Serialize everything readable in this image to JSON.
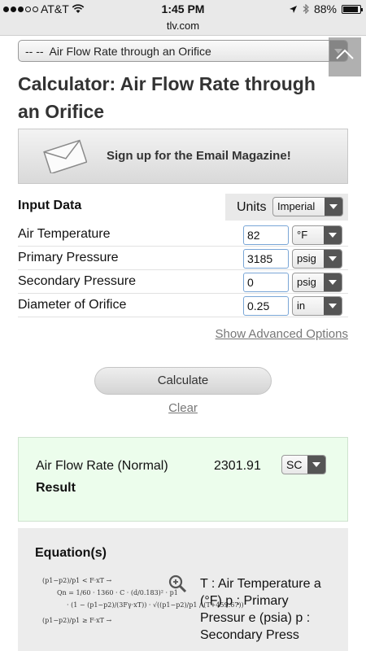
{
  "status_bar": {
    "carrier": "AT&T",
    "time": "1:45 PM",
    "battery": "88%",
    "battery_level": 0.88
  },
  "url": "tlv.com",
  "calculator_select": {
    "selected": "-- --  Air Flow Rate through an Orifice"
  },
  "page_title": "Calculator: Air Flow Rate through an Orifice",
  "banner": {
    "text": "Sign up for the Email Magazine!"
  },
  "input": {
    "heading": "Input Data",
    "units_label": "Units",
    "units_value": "Imperial",
    "rows": [
      {
        "label": "Air Temperature",
        "value": "82",
        "unit": "°F"
      },
      {
        "label": "Primary Pressure",
        "value": "3185",
        "unit": "psig"
      },
      {
        "label": "Secondary Pressure",
        "value": "0",
        "unit": "psig"
      },
      {
        "label": "Diameter of Orifice",
        "value": "0.25",
        "unit": "in"
      }
    ],
    "advanced_link": "Show Advanced Options"
  },
  "actions": {
    "calculate": "Calculate",
    "clear": "Clear"
  },
  "result": {
    "label": "Air Flow Rate (Normal)",
    "value": "2301.91",
    "unit": "SC",
    "heading": "Result"
  },
  "equations": {
    "heading": "Equation(s)",
    "lines": [
      "(p1−p2)/p1 < F·xT →",
      "Qn = 1/60 · 1360 · C · (d/0.183)² · p1",
      "· (1 − (p1−p2)/(3Fγ·xT)) · √((p1−p2)/p1 / (T+459.67))",
      "(p1−p2)/p1 ≥ F·xT →"
    ],
    "legend": "T : Air Temperature a (°F) p : Primary Pressur e (psia) p : Secondary Press"
  }
}
